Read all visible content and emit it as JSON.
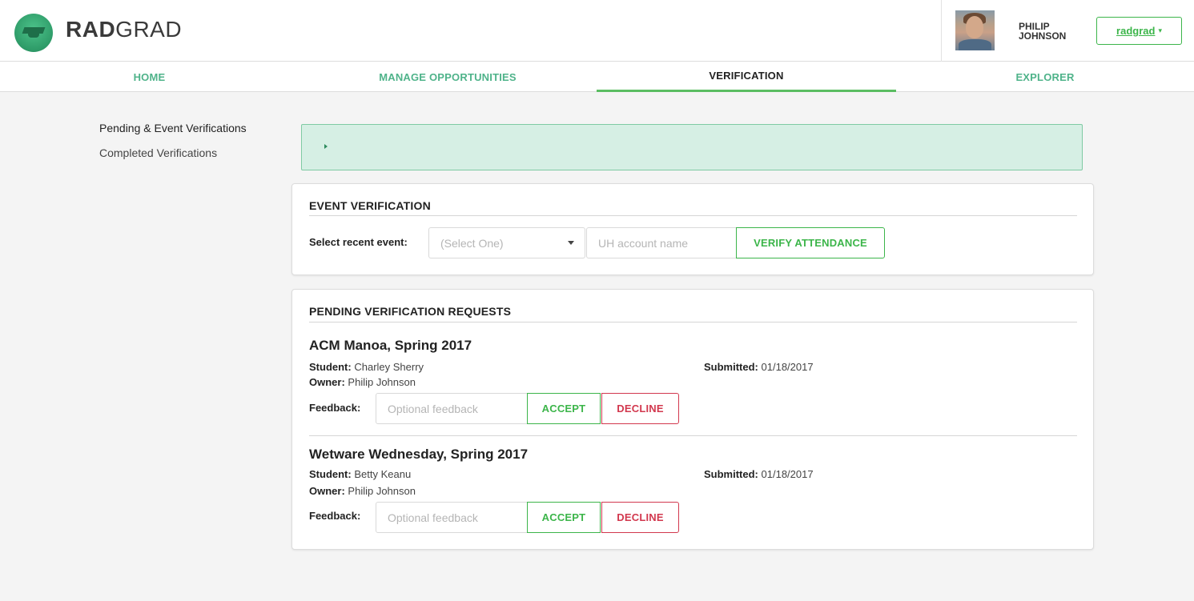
{
  "header": {
    "brand_bold": "RAD",
    "brand_rest": "GRAD",
    "user_first": "PHILIP",
    "user_last": "JOHNSON",
    "user_menu_label": "radgrad",
    "caret": "▾"
  },
  "nav": {
    "items": [
      {
        "label": "HOME"
      },
      {
        "label": "MANAGE OPPORTUNITIES"
      },
      {
        "label": "VERIFICATION"
      },
      {
        "label": "EXPLORER"
      }
    ],
    "active": "VERIFICATION"
  },
  "sidebar": {
    "items": [
      {
        "label": "Pending & Event Verifications"
      },
      {
        "label": "Completed Verifications"
      }
    ]
  },
  "event_verification": {
    "title": "EVENT VERIFICATION",
    "select_label": "Select recent event:",
    "select_placeholder": "(Select One)",
    "account_placeholder": "UH account name",
    "verify_button": "VERIFY ATTENDANCE"
  },
  "pending": {
    "title": "PENDING VERIFICATION REQUESTS",
    "labels": {
      "student": "Student:",
      "owner": "Owner:",
      "submitted": "Submitted:",
      "feedback": "Feedback:",
      "feedback_placeholder": "Optional feedback",
      "accept": "ACCEPT",
      "decline": "DECLINE"
    },
    "requests": [
      {
        "title": "ACM Manoa, Spring 2017",
        "student": "Charley Sherry",
        "owner": "Philip Johnson",
        "submitted": "01/18/2017"
      },
      {
        "title": "Wetware Wednesday, Spring 2017",
        "student": "Betty Keanu",
        "owner": "Philip Johnson",
        "submitted": "01/18/2017"
      }
    ]
  },
  "colors": {
    "accent_green": "#3cb54a",
    "nav_teal": "#4fb38a",
    "decline_red": "#d2384e",
    "info_bg": "#d6efe4"
  }
}
